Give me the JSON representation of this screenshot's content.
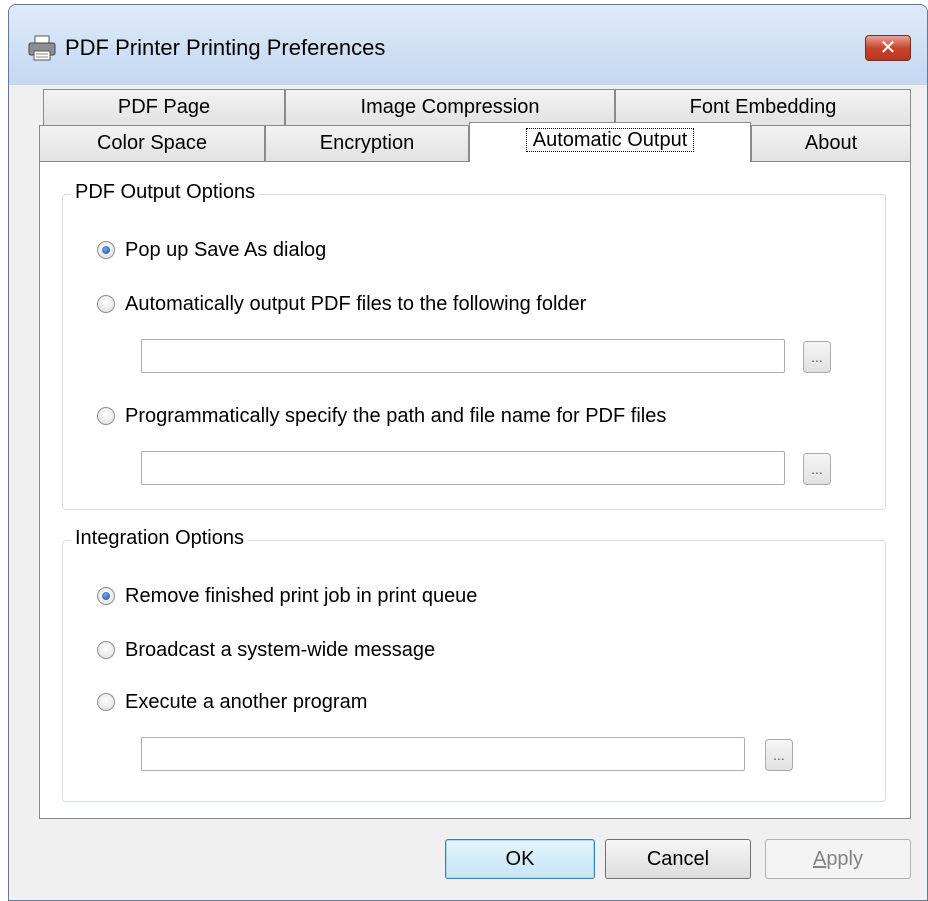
{
  "window": {
    "title": "PDF Printer Printing Preferences",
    "close_symbol": "✕"
  },
  "tabs": {
    "row1": [
      "PDF Page",
      "Image Compression",
      "Font Embedding"
    ],
    "row2": [
      "Color Space",
      "Encryption",
      "Automatic Output",
      "About"
    ],
    "active": "Automatic Output"
  },
  "output_group": {
    "title": "PDF Output Options",
    "options": [
      {
        "label": "Pop up Save As dialog",
        "checked": true
      },
      {
        "label": "Automatically output PDF files to the following folder",
        "checked": false
      },
      {
        "label": "Programmatically specify the path and file name for PDF files",
        "checked": false
      }
    ],
    "folder_value": "",
    "path_value": "",
    "browse_label": "..."
  },
  "integration_group": {
    "title": "Integration Options",
    "options": [
      {
        "label": "Remove finished print job in print queue",
        "checked": true
      },
      {
        "label": "Broadcast a system-wide message",
        "checked": false
      },
      {
        "label": "Execute a another program",
        "checked": false
      }
    ],
    "program_value": "",
    "browse_label": "..."
  },
  "buttons": {
    "ok": "OK",
    "cancel": "Cancel",
    "apply_prefix": "",
    "apply_underlined": "A",
    "apply_rest": "pply"
  },
  "colors": {
    "titlebar": "#c9dcf2",
    "close_button": "#c7452e",
    "radio_checked": "#1c4f9c",
    "default_button": "#c4e5f6"
  }
}
